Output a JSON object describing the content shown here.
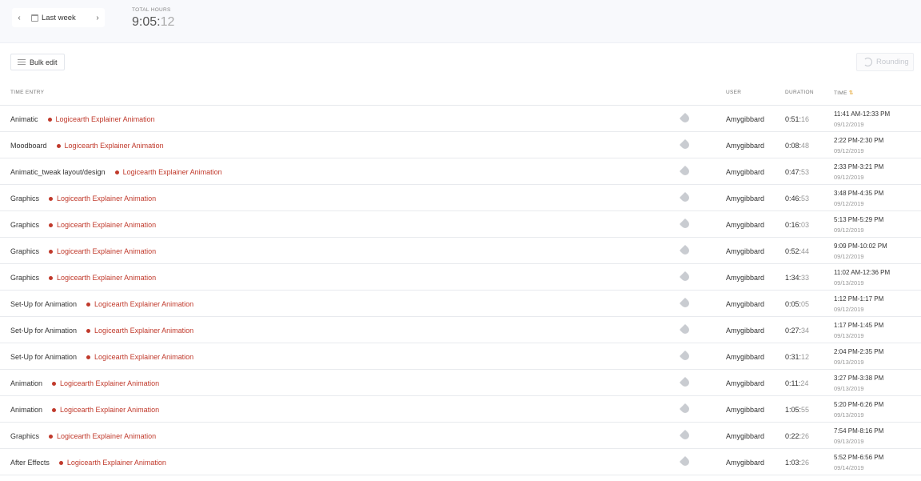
{
  "header": {
    "prev_label": "‹",
    "next_label": "›",
    "range_label": "Last week",
    "total_hours_caption": "TOTAL HOURS",
    "total_main": "9:05:",
    "total_sec": "12"
  },
  "toolbar": {
    "bulk_edit_label": "Bulk edit",
    "rounding_label": "Rounding"
  },
  "table": {
    "columns": {
      "entry": "TIME ENTRY",
      "user": "USER",
      "duration": "DURATION",
      "time": "TIME"
    },
    "rows": [
      {
        "desc": "Animatic",
        "project": "Logicearth Explainer Animation",
        "user": "Amygibbard",
        "dur_main": "0:51:",
        "dur_sec": "16",
        "time": "11:41 AM-12:33 PM",
        "date": "09/12/2019"
      },
      {
        "desc": "Moodboard",
        "project": "Logicearth Explainer Animation",
        "user": "Amygibbard",
        "dur_main": "0:08:",
        "dur_sec": "48",
        "time": "2:22 PM-2:30 PM",
        "date": "09/12/2019"
      },
      {
        "desc": "Animatic_tweak layout/design",
        "project": "Logicearth Explainer Animation",
        "user": "Amygibbard",
        "dur_main": "0:47:",
        "dur_sec": "53",
        "time": "2:33 PM-3:21 PM",
        "date": "09/12/2019"
      },
      {
        "desc": "Graphics",
        "project": "Logicearth Explainer Animation",
        "user": "Amygibbard",
        "dur_main": "0:46:",
        "dur_sec": "53",
        "time": "3:48 PM-4:35 PM",
        "date": "09/12/2019"
      },
      {
        "desc": "Graphics",
        "project": "Logicearth Explainer Animation",
        "user": "Amygibbard",
        "dur_main": "0:16:",
        "dur_sec": "03",
        "time": "5:13 PM-5:29 PM",
        "date": "09/12/2019"
      },
      {
        "desc": "Graphics",
        "project": "Logicearth Explainer Animation",
        "user": "Amygibbard",
        "dur_main": "0:52:",
        "dur_sec": "44",
        "time": "9:09 PM-10:02 PM",
        "date": "09/12/2019"
      },
      {
        "desc": "Graphics",
        "project": "Logicearth Explainer Animation",
        "user": "Amygibbard",
        "dur_main": "1:34:",
        "dur_sec": "33",
        "time": "11:02 AM-12:36 PM",
        "date": "09/13/2019"
      },
      {
        "desc": "Set-Up for Animation",
        "project": "Logicearth Explainer Animation",
        "user": "Amygibbard",
        "dur_main": "0:05:",
        "dur_sec": "05",
        "time": "1:12 PM-1:17 PM",
        "date": "09/12/2019"
      },
      {
        "desc": "Set-Up for Animation",
        "project": "Logicearth Explainer Animation",
        "user": "Amygibbard",
        "dur_main": "0:27:",
        "dur_sec": "34",
        "time": "1:17 PM-1:45 PM",
        "date": "09/13/2019"
      },
      {
        "desc": "Set-Up for Animation",
        "project": "Logicearth Explainer Animation",
        "user": "Amygibbard",
        "dur_main": "0:31:",
        "dur_sec": "12",
        "time": "2:04 PM-2:35 PM",
        "date": "09/13/2019"
      },
      {
        "desc": "Animation",
        "project": "Logicearth Explainer Animation",
        "user": "Amygibbard",
        "dur_main": "0:11:",
        "dur_sec": "24",
        "time": "3:27 PM-3:38 PM",
        "date": "09/13/2019"
      },
      {
        "desc": "Animation",
        "project": "Logicearth Explainer Animation",
        "user": "Amygibbard",
        "dur_main": "1:05:",
        "dur_sec": "55",
        "time": "5:20 PM-6:26 PM",
        "date": "09/13/2019"
      },
      {
        "desc": "Graphics",
        "project": "Logicearth Explainer Animation",
        "user": "Amygibbard",
        "dur_main": "0:22:",
        "dur_sec": "26",
        "time": "7:54 PM-8:16 PM",
        "date": "09/13/2019"
      },
      {
        "desc": "After Effects",
        "project": "Logicearth Explainer Animation",
        "user": "Amygibbard",
        "dur_main": "1:03:",
        "dur_sec": "26",
        "time": "5:52 PM-6:56 PM",
        "date": "09/14/2019"
      }
    ]
  },
  "colors": {
    "project": "#c0392b",
    "sort_indicator": "#e5a93a"
  }
}
